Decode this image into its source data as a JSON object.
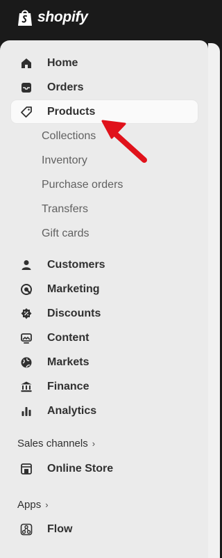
{
  "brand": {
    "name": "shopify"
  },
  "nav": {
    "home": "Home",
    "orders": "Orders",
    "products": "Products",
    "collections": "Collections",
    "inventory": "Inventory",
    "purchase_orders": "Purchase orders",
    "transfers": "Transfers",
    "gift_cards": "Gift cards",
    "customers": "Customers",
    "marketing": "Marketing",
    "discounts": "Discounts",
    "content": "Content",
    "markets": "Markets",
    "finance": "Finance",
    "analytics": "Analytics"
  },
  "sales_channels": {
    "title": "Sales channels",
    "online_store": "Online Store"
  },
  "apps": {
    "title": "Apps",
    "flow": "Flow"
  },
  "colors": {
    "topbar": "#1a1a1a",
    "sidebar": "#ebebeb",
    "selected_bg": "#fafafa",
    "annotation_arrow": "#e0121b"
  },
  "icons": [
    "store-bag-icon",
    "home-icon",
    "inbox-icon",
    "tag-icon",
    "person-icon",
    "target-icon",
    "discount-icon",
    "image-icon",
    "globe-icon",
    "bank-icon",
    "bar-chart-icon",
    "online-store-icon",
    "flow-icon",
    "chevron-right-icon",
    "red-arrow-icon"
  ]
}
